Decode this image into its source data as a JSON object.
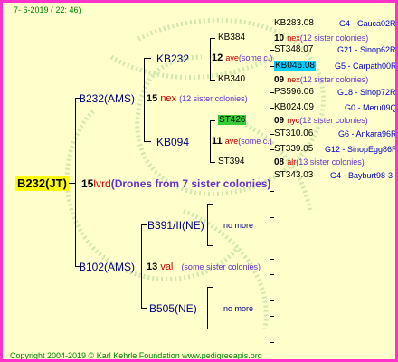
{
  "header": {
    "date": "7-  6-2019 ( 22: 46)"
  },
  "footer": {
    "copyright": "Copyright 2004-2019 © Karl Kehrle Foundation   www.pedigreeapis.org"
  },
  "root": {
    "name": "B232(JT)",
    "gen_num": "15",
    "gen_code": "lvrd",
    "gen_desc": "(Drones from 7 sister colonies)"
  },
  "dam": {
    "name": "B232(AMS)",
    "gen_num": "15",
    "gen_code": "nex",
    "gen_desc": "(12 sister colonies)"
  },
  "sire": {
    "name": "B102(AMS)",
    "gen_num": "13",
    "gen_code": "val",
    "gen_desc": "(some sister colonies)"
  },
  "dd": {
    "name": "KB232",
    "gen_num": "12",
    "gen_code": "ave",
    "gen_desc": "(some c.)"
  },
  "ds": {
    "name": "KB094",
    "gen_num": "11",
    "gen_code": "ave",
    "gen_desc": "(some c.)"
  },
  "sd": {
    "name": "B391/II(NE)",
    "more": "no more"
  },
  "ss": {
    "name": "B505(NE)",
    "more": "no more"
  },
  "ddd": {
    "name": "KB384",
    "gen_num": "10",
    "gen_code": "nex",
    "gen_desc": "(12 sister colonies)"
  },
  "dds": {
    "name": "KB340",
    "gen_num": "09",
    "gen_code": "nex",
    "gen_desc": "(12 sister colonies)"
  },
  "dsd": {
    "name": "ST426",
    "gen_num": "09",
    "gen_code": "nyc",
    "gen_desc": "(12 sister colonies)"
  },
  "dss": {
    "name": "ST394",
    "gen_num": "08",
    "gen_code": "alr",
    "gen_desc": "(13 sister colonies)"
  },
  "leaves": [
    {
      "name": "KB283.08",
      "info": "G4 - Cauca02R"
    },
    {
      "name": "ST348.07",
      "info": "G21 - Sinop62R"
    },
    {
      "name": "KB046.08",
      "info": "G5 - Carpath00R"
    },
    {
      "name": "PS596.06",
      "info": "G18 - Sinop72R"
    },
    {
      "name": "KB024.09",
      "info": "G0 - Meru09Q"
    },
    {
      "name": "ST310.06",
      "info": "G6 - Ankara96R"
    },
    {
      "name": "ST339.05",
      "info": "G12 - SinopEgg86R"
    },
    {
      "name": "ST343.03",
      "info": "G4 - Bayburt98-3"
    }
  ],
  "colors": {
    "border": "#ff33cc",
    "background": "#ffffcc",
    "root_highlight": "#ffff00",
    "cyan_highlight": "#00ccff",
    "green_highlight": "#33cc33"
  }
}
